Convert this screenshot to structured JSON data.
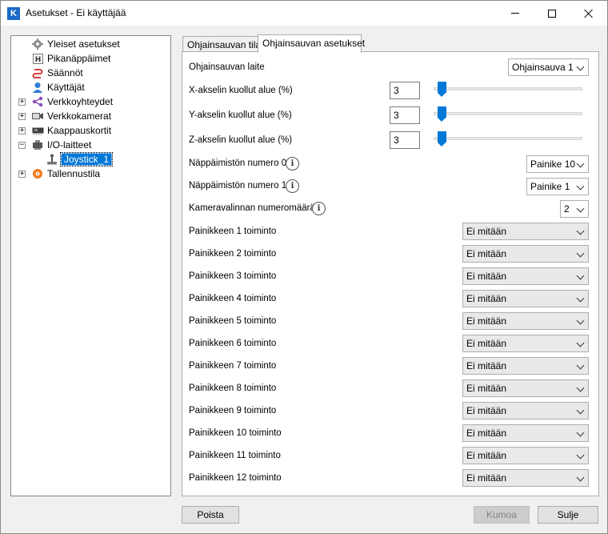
{
  "window": {
    "title": "Asetukset - Ei käyttäjää",
    "app_icon_letter": "K"
  },
  "tree": {
    "items": [
      {
        "label": "Yleiset asetukset",
        "icon": "gear-icon"
      },
      {
        "label": "Pikanäppäimet",
        "icon": "hotkey-icon"
      },
      {
        "label": "Säännöt",
        "icon": "rules-icon"
      },
      {
        "label": "Käyttäjät",
        "icon": "user-icon"
      },
      {
        "label": "Verkkoyhteydet",
        "icon": "network-icon",
        "expander": "+"
      },
      {
        "label": "Verkkokamerat",
        "icon": "camera-icon",
        "expander": "+"
      },
      {
        "label": "Kaappauskortit",
        "icon": "capture-card-icon",
        "expander": "+"
      },
      {
        "label": "I/O-laitteet",
        "icon": "io-device-icon",
        "expander": "−"
      },
      {
        "label": "Joystick_1",
        "icon": "joystick-icon",
        "selected": true
      },
      {
        "label": "Tallennustila",
        "icon": "storage-icon",
        "expander": "+"
      }
    ]
  },
  "tabs": [
    {
      "label": "Ohjainsauvan tila"
    },
    {
      "label": "Ohjainsauvan asetukset",
      "active": true
    }
  ],
  "settings": {
    "device_label": "Ohjainsauvan laite",
    "device_value": "Ohjainsauva 1",
    "deadzones": [
      {
        "label": "X-akselin kuollut alue (%)",
        "value": "3",
        "level_percent": 3
      },
      {
        "label": "Y-akselin kuollut alue (%)",
        "value": "3",
        "level_percent": 3
      },
      {
        "label": "Z-akselin kuollut alue (%)",
        "value": "3",
        "level_percent": 3
      }
    ],
    "keypad0_label": "Näppäimistön numero 0",
    "keypad0_value": "Painike 10",
    "keypad1_label": "Näppäimistön numero 1",
    "keypad1_value": "Painike 1",
    "camera_count_label": "Kameravalinnan numeromäärä",
    "camera_count_value": "2",
    "info_glyph": "i",
    "button_actions": [
      {
        "label": "Painikkeen 1 toiminto",
        "value": "Ei mitään"
      },
      {
        "label": "Painikkeen 2 toiminto",
        "value": "Ei mitään"
      },
      {
        "label": "Painikkeen 3 toiminto",
        "value": "Ei mitään"
      },
      {
        "label": "Painikkeen 4 toiminto",
        "value": "Ei mitään"
      },
      {
        "label": "Painikkeen 5 toiminto",
        "value": "Ei mitään"
      },
      {
        "label": "Painikkeen 6 toiminto",
        "value": "Ei mitään"
      },
      {
        "label": "Painikkeen 7 toiminto",
        "value": "Ei mitään"
      },
      {
        "label": "Painikkeen 8 toiminto",
        "value": "Ei mitään"
      },
      {
        "label": "Painikkeen 9 toiminto",
        "value": "Ei mitään"
      },
      {
        "label": "Painikkeen 10 toiminto",
        "value": "Ei mitään"
      },
      {
        "label": "Painikkeen 11 toiminto",
        "value": "Ei mitään"
      },
      {
        "label": "Painikkeen 12 toiminto",
        "value": "Ei mitään"
      }
    ]
  },
  "footer": {
    "delete_label": "Poista",
    "cancel_label": "Kumoa",
    "close_label": "Sulje"
  },
  "colors": {
    "accent": "#0078d7",
    "selection": "#0078d7"
  }
}
